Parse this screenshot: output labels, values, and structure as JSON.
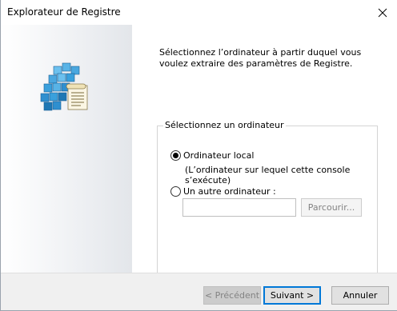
{
  "window": {
    "title": "Explorateur de Registre"
  },
  "intro": {
    "text": "Sélectionnez l’ordinateur à partir duquel vous voulez extraire des paramètres de Registre."
  },
  "group": {
    "legend": "Sélectionnez un ordinateur",
    "options": [
      {
        "label": "Ordinateur local",
        "sublabel": "(L’ordinateur sur lequel cette console s’exécute)",
        "checked": true
      },
      {
        "label": "Un autre ordinateur :",
        "checked": false
      }
    ],
    "computer_input": {
      "value": "",
      "placeholder": ""
    },
    "browse_label": "Parcourir..."
  },
  "footer": {
    "back_label": "< Précédent",
    "next_label": "Suivant >",
    "cancel_label": "Annuler"
  },
  "icons": {
    "close": "close-icon",
    "wizard": "registry-wizard-icon"
  },
  "colors": {
    "cube_blue": "#3aa0dc",
    "cube_dark": "#1f78b4",
    "default_button_border": "#0078d7"
  }
}
